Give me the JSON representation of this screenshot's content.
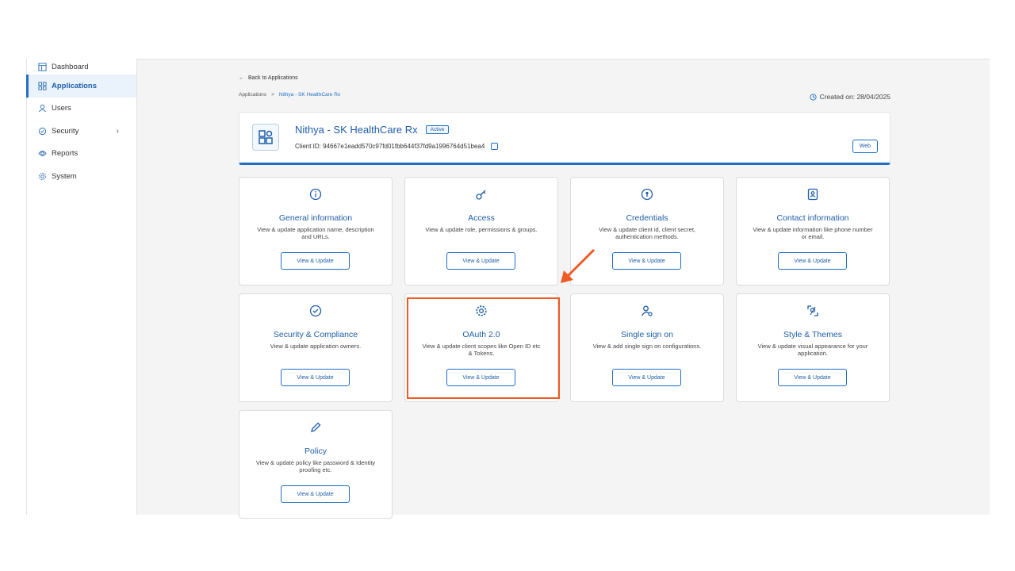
{
  "sidebar": {
    "items": [
      {
        "label": "Dashboard",
        "icon": "dashboard-icon"
      },
      {
        "label": "Applications",
        "icon": "grid-icon"
      },
      {
        "label": "Users",
        "icon": "user-icon"
      },
      {
        "label": "Security",
        "icon": "shield-icon"
      },
      {
        "label": "Reports",
        "icon": "reports-icon"
      },
      {
        "label": "System",
        "icon": "gear-icon"
      }
    ]
  },
  "header": {
    "back_label": "Back to Applications",
    "breadcrumb": [
      "Applications",
      ">",
      "Nithya - SK HealthCare Rx"
    ],
    "created_on": "Created on: 28/04/2025"
  },
  "app": {
    "name": "Nithya - SK HealthCare Rx",
    "status": "Active",
    "client_id": "Client ID: 94667e1eadd570c97fd01fbb644f37fd9a1996764d51bea4",
    "type": "Web"
  },
  "cards": [
    {
      "title": "General information",
      "desc": "View & update application name, description and URLs.",
      "button": "View & Update",
      "icon": "info-icon"
    },
    {
      "title": "Access",
      "desc": "View & update role, permissions & groups.",
      "button": "View & Update",
      "icon": "key-icon"
    },
    {
      "title": "Credentials",
      "desc": "View & update client id, client secret, authentication methods.",
      "button": "View & Update",
      "icon": "credentials-icon"
    },
    {
      "title": "Contact information",
      "desc": "View & update information like phone number or email.",
      "button": "View & Update",
      "icon": "contact-card-icon"
    },
    {
      "title": "Security & Compliance",
      "desc": "View & update application owners.",
      "button": "View & Update",
      "icon": "shield-check-icon"
    },
    {
      "title": "OAuth 2.0",
      "desc": "View & update client scopes like Open ID etc & Tokens.",
      "button": "View & Update",
      "icon": "gear-icon"
    },
    {
      "title": "Single sign on",
      "desc": "View & add single sign on configurations.",
      "button": "View & Update",
      "icon": "user-settings-icon"
    },
    {
      "title": "Style & Themes",
      "desc": "View & update visual appearance for your application.",
      "button": "View & Update",
      "icon": "palette-icon"
    },
    {
      "title": "Policy",
      "desc": "View & update policy like password & Identity proofing etc.",
      "button": "View & Update",
      "icon": "pen-icon"
    }
  ],
  "colors": {
    "accent": "#1f6fc5",
    "highlight": "#f05a24"
  }
}
